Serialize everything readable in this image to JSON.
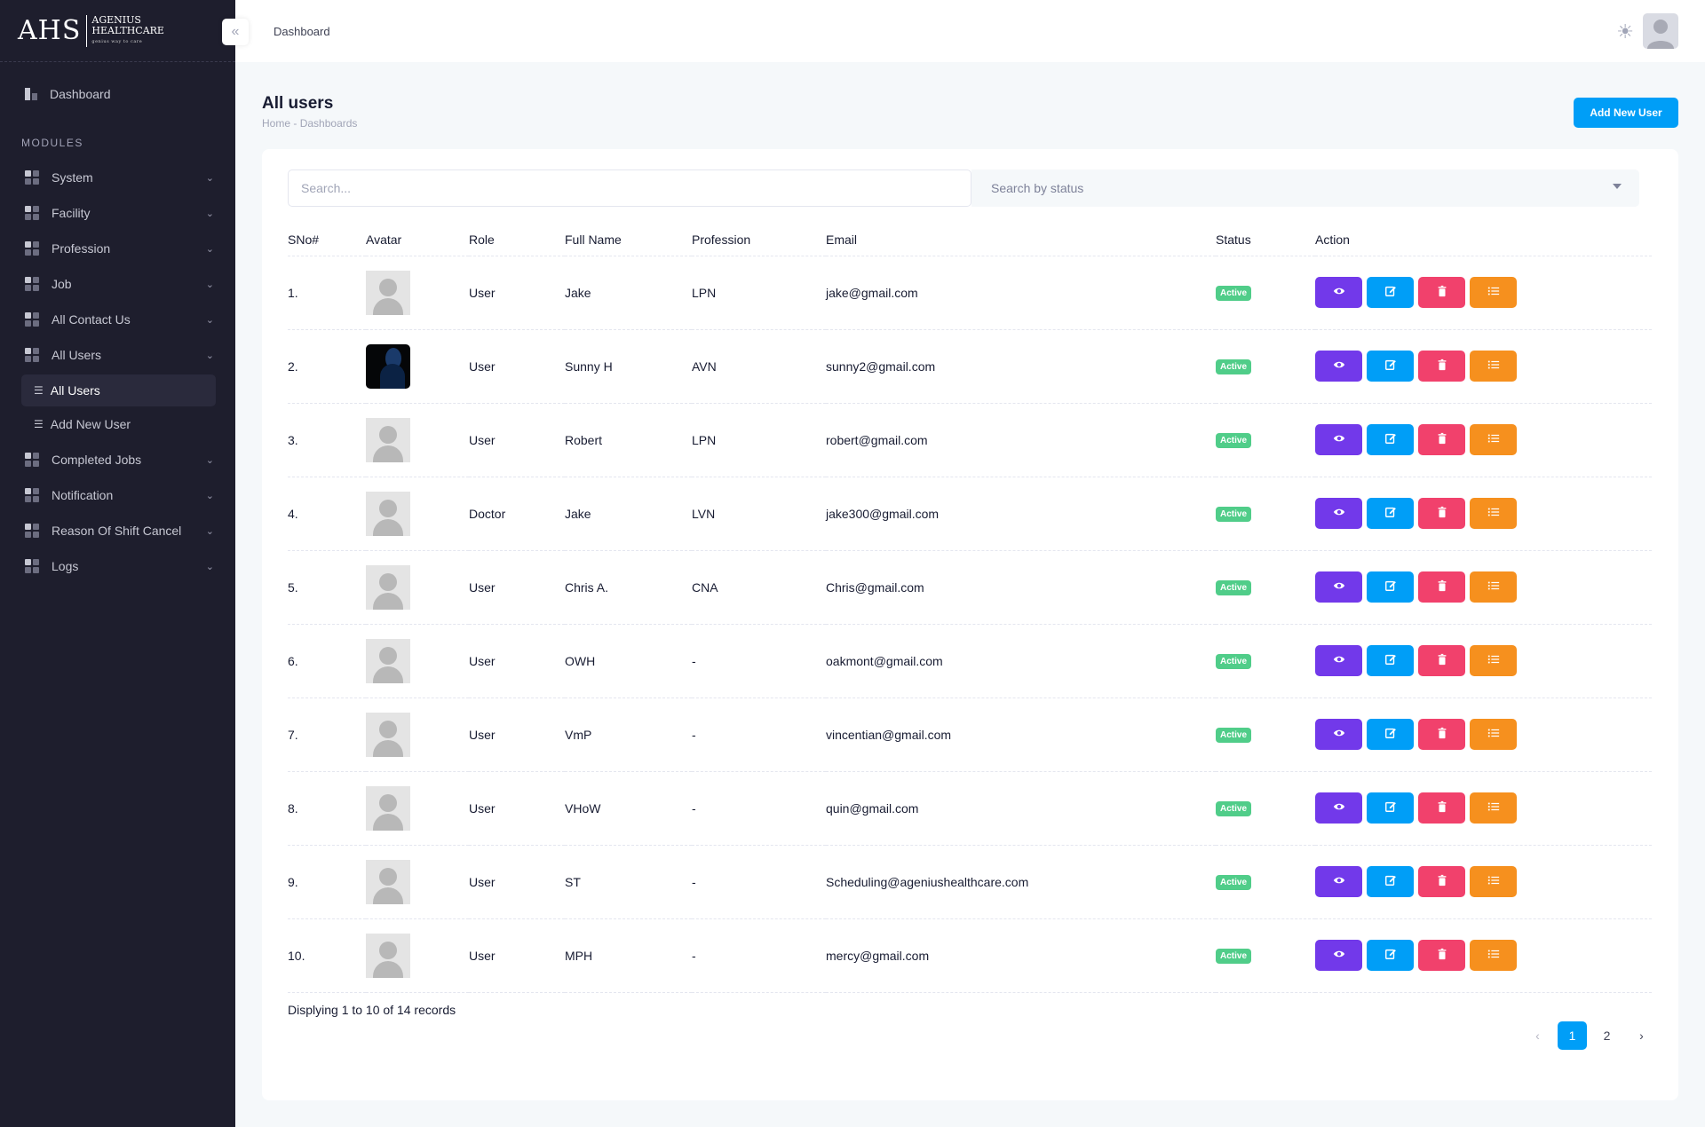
{
  "brand": {
    "mark": "AHS",
    "name_line1": "AGENIUS",
    "name_line2": "HEALTHCARE",
    "tagline": "genius way to care"
  },
  "sidebar": {
    "dashboard": "Dashboard",
    "modules_label": "MODULES",
    "items": [
      {
        "label": "System"
      },
      {
        "label": "Facility"
      },
      {
        "label": "Profession"
      },
      {
        "label": "Job"
      },
      {
        "label": "All Contact Us"
      },
      {
        "label": "All Users"
      },
      {
        "label": "Completed Jobs"
      },
      {
        "label": "Notification"
      },
      {
        "label": "Reason Of Shift Cancel"
      },
      {
        "label": "Logs"
      }
    ],
    "sub_items": [
      {
        "label": "All Users"
      },
      {
        "label": "Add New User"
      }
    ]
  },
  "header": {
    "breadcrumb": "Dashboard"
  },
  "page": {
    "title": "All users",
    "breadcrumb_home": "Home",
    "breadcrumb_sep": "-",
    "breadcrumb_current": "Dashboards",
    "add_button": "Add New User"
  },
  "filters": {
    "search_placeholder": "Search...",
    "status_placeholder": "Search by status"
  },
  "table": {
    "headers": [
      "SNo#",
      "Avatar",
      "Role",
      "Full Name",
      "Profession",
      "Email",
      "Status",
      "Action"
    ],
    "rows": [
      {
        "sno": "1.",
        "role": "User",
        "name": "Jake",
        "profession": "LPN",
        "email": "jake@gmail.com",
        "status": "Active"
      },
      {
        "sno": "2.",
        "role": "User",
        "name": "Sunny H",
        "profession": "AVN",
        "email": "sunny2@gmail.com",
        "status": "Active"
      },
      {
        "sno": "3.",
        "role": "User",
        "name": "Robert",
        "profession": "LPN",
        "email": "robert@gmail.com",
        "status": "Active"
      },
      {
        "sno": "4.",
        "role": "Doctor",
        "name": "Jake",
        "profession": "LVN",
        "email": "jake300@gmail.com",
        "status": "Active"
      },
      {
        "sno": "5.",
        "role": "User",
        "name": "Chris A.",
        "profession": "CNA",
        "email": "Chris@gmail.com",
        "status": "Active"
      },
      {
        "sno": "6.",
        "role": "User",
        "name": "OWH",
        "profession": "-",
        "email": "oakmont@gmail.com",
        "status": "Active"
      },
      {
        "sno": "7.",
        "role": "User",
        "name": "VmP",
        "profession": "-",
        "email": "vincentian@gmail.com",
        "status": "Active"
      },
      {
        "sno": "8.",
        "role": "User",
        "name": "VHoW",
        "profession": "-",
        "email": "quin@gmail.com",
        "status": "Active"
      },
      {
        "sno": "9.",
        "role": "User",
        "name": "ST",
        "profession": "-",
        "email": "Scheduling@ageniushealthcare.com",
        "status": "Active"
      },
      {
        "sno": "10.",
        "role": "User",
        "name": "MPH",
        "profession": "-",
        "email": "mercy@gmail.com",
        "status": "Active"
      }
    ]
  },
  "footer": {
    "summary": "Displying 1 to 10 of 14 records",
    "prev": "‹",
    "pages": [
      "1",
      "2"
    ],
    "next": "›"
  },
  "colors": {
    "primary": "#009ef7",
    "view": "#7239ea",
    "delete": "#f1416c",
    "list": "#f6901e",
    "active_badge": "#50cd89",
    "sidebar_bg": "#1e1e2d"
  }
}
